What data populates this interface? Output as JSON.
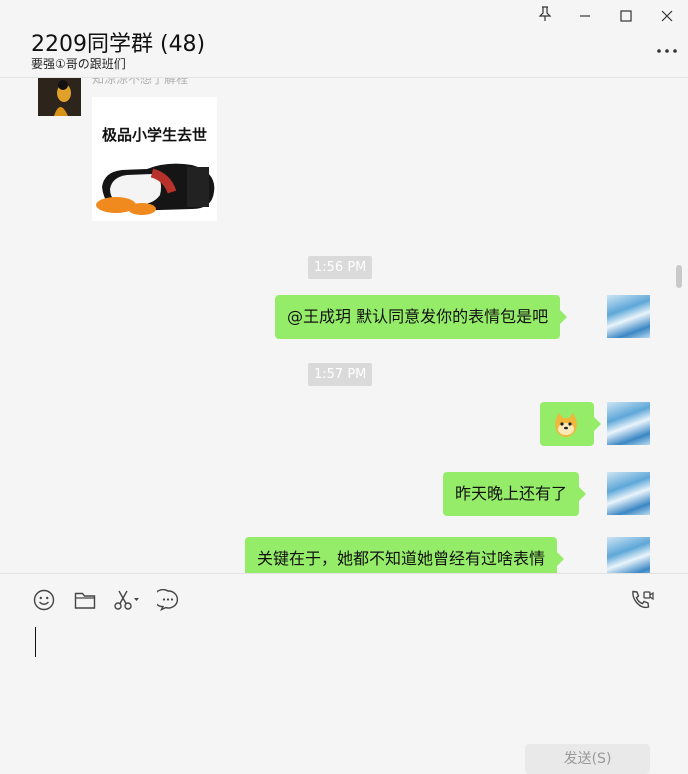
{
  "header": {
    "title": "2209同学群 (48)",
    "subtitle": "要强①哥の跟班们"
  },
  "messages": {
    "sender_name": "知涼涼不想了解程",
    "sticker_caption": "极品小学生去世",
    "time_1": "1:56 PM",
    "msg_1": "@王成玥 默认同意发你的表情包是吧",
    "time_2": "1:57 PM",
    "msg_2_emoji": "doge",
    "msg_3": "昨天晚上还有了",
    "msg_4": "关键在于，她都不知道她曾经有过啥表情"
  },
  "input": {
    "send_label": "发送(S)",
    "value": ""
  },
  "colors": {
    "bubble": "#95ec69",
    "background": "#f5f5f5"
  },
  "icons": [
    "pin-icon",
    "minimize-icon",
    "maximize-icon",
    "close-icon",
    "more-icon",
    "emoji-icon",
    "folder-icon",
    "scissors-icon",
    "chat-history-icon",
    "video-call-icon"
  ]
}
